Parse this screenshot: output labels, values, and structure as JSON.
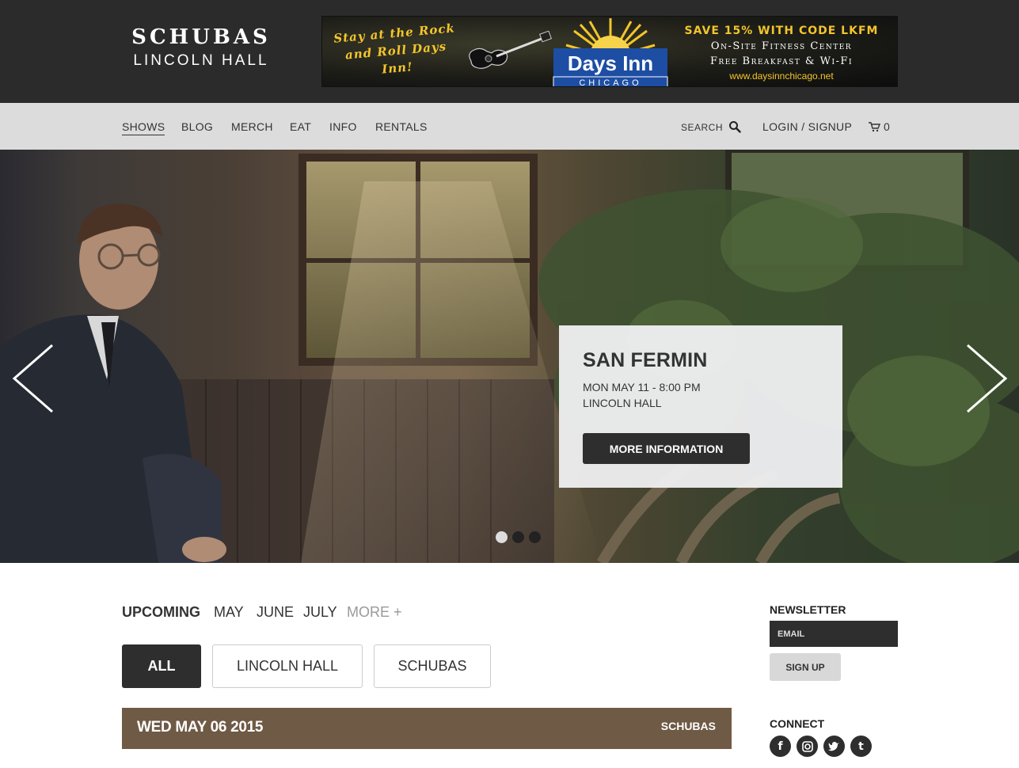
{
  "header": {
    "logo_line1": "SCHUBAS",
    "logo_line2": "LINCOLN HALL",
    "ad": {
      "left_text": "Stay at the Rock and Roll Days Inn!",
      "brand": "Days Inn",
      "brand_city": "CHICAGO",
      "offer": "SAVE 15% WITH CODE LKFM",
      "features": [
        "On-Site Fitness Center",
        "Free Breakfast & Wi-Fi"
      ],
      "url": "www.daysinnchicago.net"
    }
  },
  "nav": {
    "items": [
      "SHOWS",
      "BLOG",
      "MERCH",
      "EAT",
      "INFO",
      "RENTALS"
    ],
    "search_label": "SEARCH",
    "login": "LOGIN / SIGNUP",
    "cart_count": "0"
  },
  "hero": {
    "show_title": "SAN FERMIN",
    "show_date": "MON MAY 11 - 8:00 PM",
    "show_venue": "LINCOLN HALL",
    "button": "MORE INFORMATION",
    "slide_count": 3,
    "active_slide": 1
  },
  "filters": {
    "months": [
      "UPCOMING",
      "MAY",
      "JUNE",
      "JULY",
      "MORE +"
    ],
    "venues": [
      "ALL",
      "LINCOLN HALL",
      "SCHUBAS"
    ]
  },
  "listing": {
    "date": "WED MAY 06 2015",
    "venue": "SCHUBAS"
  },
  "sidebar": {
    "newsletter_title": "NEWSLETTER",
    "email_placeholder": "EMAIL",
    "signup": "SIGN UP",
    "connect_title": "CONNECT",
    "social": [
      "facebook",
      "instagram",
      "twitter",
      "tumblr"
    ]
  },
  "colors": {
    "header_bg": "#2b2b2b",
    "nav_bg": "#dcdcdc",
    "date_bar": "#6f5a45",
    "ad_yellow": "#f3c52a",
    "days_inn_blue": "#1d4ea3"
  }
}
